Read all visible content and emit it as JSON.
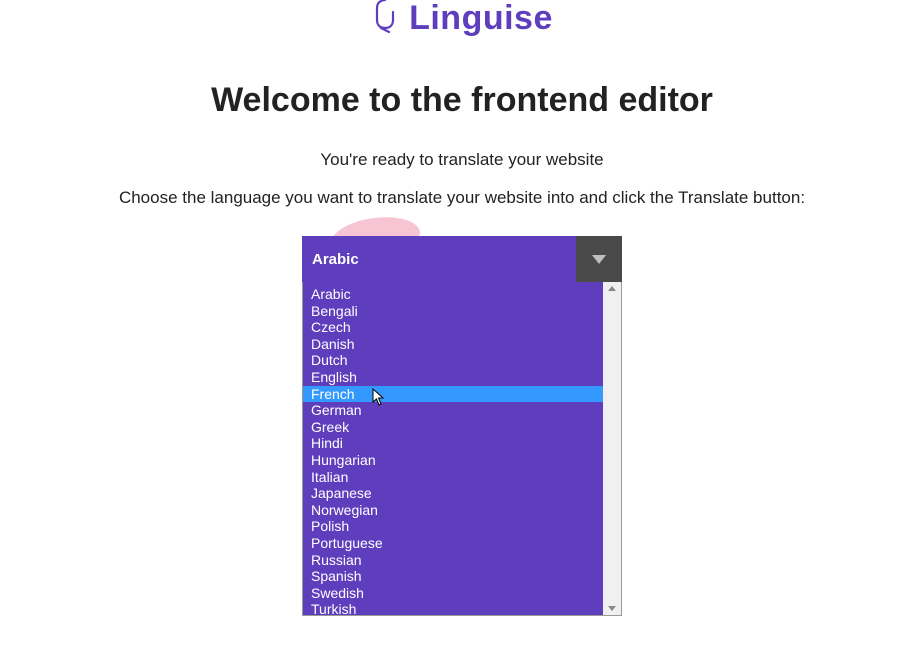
{
  "logo": {
    "text": "Linguise"
  },
  "heading": "Welcome to the frontend editor",
  "subheading": "You're ready to translate your website",
  "instruction": "Choose the language you want to translate your website into and click the Translate button:",
  "select": {
    "selected": "Arabic",
    "highlighted_index": 6,
    "options": [
      "Arabic",
      "Bengali",
      "Czech",
      "Danish",
      "Dutch",
      "English",
      "French",
      "German",
      "Greek",
      "Hindi",
      "Hungarian",
      "Italian",
      "Japanese",
      "Norwegian",
      "Polish",
      "Portuguese",
      "Russian",
      "Spanish",
      "Swedish",
      "Turkish"
    ]
  },
  "colors": {
    "brand": "#5f3ebd",
    "highlight": "#3399ff"
  }
}
